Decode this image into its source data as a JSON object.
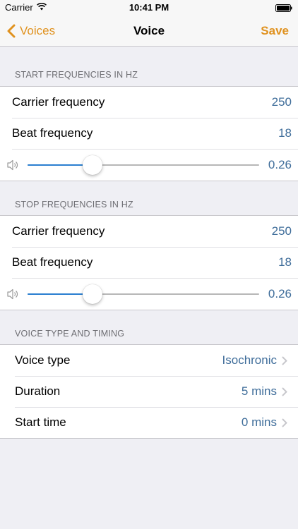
{
  "status_bar": {
    "carrier": "Carrier",
    "time": "10:41 PM"
  },
  "nav": {
    "back_label": "Voices",
    "title": "Voice",
    "save_label": "Save"
  },
  "colors": {
    "accent": "#e0921f",
    "value_blue": "#3f6d9a",
    "slider_fill": "#2a7fd0"
  },
  "start_section": {
    "header": "START FREQUENCIES IN HZ",
    "carrier_label": "Carrier frequency",
    "carrier_value": "250",
    "beat_label": "Beat frequency",
    "beat_value": "18",
    "volume_value": "0.26",
    "volume_fraction": 0.28
  },
  "stop_section": {
    "header": "STOP FREQUENCIES IN HZ",
    "carrier_label": "Carrier frequency",
    "carrier_value": "250",
    "beat_label": "Beat frequency",
    "beat_value": "18",
    "volume_value": "0.26",
    "volume_fraction": 0.28
  },
  "timing_section": {
    "header": "VOICE TYPE AND TIMING",
    "voice_type_label": "Voice type",
    "voice_type_value": "Isochronic",
    "duration_label": "Duration",
    "duration_value": "5 mins",
    "start_time_label": "Start time",
    "start_time_value": "0 mins"
  }
}
